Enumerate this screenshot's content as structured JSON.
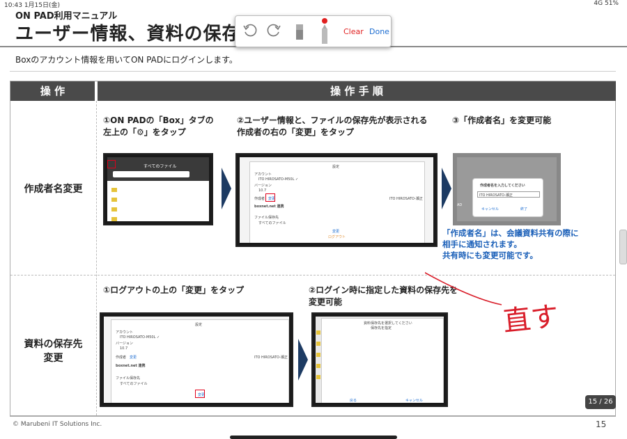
{
  "status": {
    "time": "10:43",
    "date": "1月15日(金)",
    "right": "4G 51%"
  },
  "doc_title": "ON PAD利用マニュアル",
  "title": "ユーザー情報、資料の保存先",
  "subtitle": "Boxのアカウント情報を用いてON PADにログインします。",
  "toolbar": {
    "undo_icon": "undo-icon",
    "redo_icon": "redo-icon",
    "eraser_icon": "eraser-icon",
    "pen_icon": "pen-icon",
    "clear_label": "Clear",
    "done_label": "Done",
    "pen_color": "#e02020"
  },
  "table": {
    "header_col1": "操 作",
    "header_col2": "操 作 手 順",
    "row1": {
      "label": "作成者名変更",
      "step1": {
        "line1": "①ON PADの「Box」タブの",
        "line2": "左上の「",
        "line2b": "」をタップ"
      },
      "step2": {
        "line1": "②ユーザー情報と、ファイルの保存先が表示される",
        "line2": "作成者の右の「変更」をタップ"
      },
      "step3": {
        "line1": "③「作成者名」を変更可能"
      },
      "note": {
        "line1": "「作成者名」は、会議資料共有の際に",
        "line2": "相手に通知されます。",
        "line3": "共有時にも変更可能です。"
      },
      "shot1": {
        "title": "すべてのファイル"
      },
      "shot2": {
        "header": "設定",
        "account_label": "アカウント",
        "account": "ITO HIROSATO-M50L ✓",
        "version_label": "バージョン",
        "version": "10.7",
        "author_label": "作成者",
        "change": "変更",
        "author_name": "ITO HIROSATO-瀬正",
        "boxnet": "boxnet.net 連携",
        "save_label": "ファイル保存先",
        "save_value": "すべてのファイル",
        "change_btn": "変更",
        "logout": "ログアウト"
      },
      "shot3": {
        "dialog_title": "作成者名を入力してください",
        "input_value": "ITO HIROSATO-瀬正",
        "cancel": "キャンセル",
        "ok": "終了",
        "side": "AD"
      }
    },
    "row2": {
      "label_line1": "資料の保存先",
      "label_line2": "変更",
      "step1": {
        "line1": "①ログアウトの上の「変更」をタップ"
      },
      "step2": {
        "line1": "②ログイン時に指定した資料の保存先を",
        "line2": "変更可能"
      },
      "shot4": {
        "header": "設定",
        "account_label": "アカウント",
        "account": "ITO HIROSATO-M50L ✓",
        "version_label": "バージョン",
        "version": "10.7",
        "author_label": "作成者",
        "change": "変更",
        "author_name": "ITO HIROSATO-瀬正",
        "boxnet": "boxnet.net 連携",
        "save_label": "ファイル保存先",
        "save_value": "すべてのファイル",
        "change_btn": "変更"
      },
      "shot5": {
        "line1": "資料保存先を選択してください",
        "line2": "保存先を指定",
        "cancel": "戻る",
        "ok": "キャンセル"
      }
    }
  },
  "annotation": {
    "text": "直す",
    "color": "#d91e2a"
  },
  "footer": {
    "copyright": "© Marubeni IT Solutions Inc.",
    "page": "15",
    "pill": "15 / 26"
  }
}
